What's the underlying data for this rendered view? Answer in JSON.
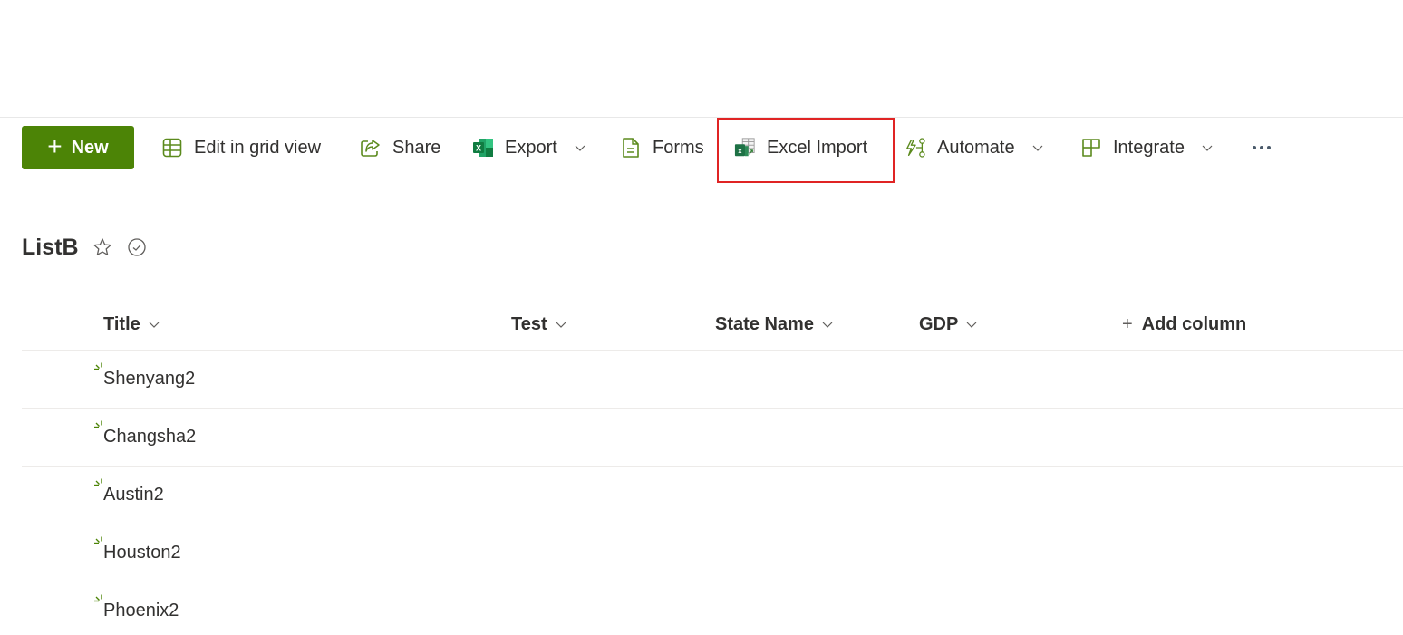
{
  "toolbar": {
    "new_label": "New",
    "items": [
      {
        "label": "Edit in grid view",
        "icon": "grid-icon",
        "has_dropdown": false
      },
      {
        "label": "Share",
        "icon": "share-icon",
        "has_dropdown": false
      },
      {
        "label": "Export",
        "icon": "excel-icon",
        "has_dropdown": true
      },
      {
        "label": "Forms",
        "icon": "form-document-icon",
        "has_dropdown": false
      },
      {
        "label": "Excel Import",
        "icon": "excel-import-icon",
        "has_dropdown": false,
        "highlighted": true
      },
      {
        "label": "Automate",
        "icon": "flow-icon",
        "has_dropdown": true
      },
      {
        "label": "Integrate",
        "icon": "integrate-icon",
        "has_dropdown": true
      }
    ],
    "more_icon": "more-ellipsis-icon"
  },
  "list": {
    "title": "ListB",
    "favorite_icon": "star-icon",
    "status_icon": "check-circle-icon",
    "columns": [
      {
        "label": "Title",
        "sortable": true
      },
      {
        "label": "Test",
        "sortable": true
      },
      {
        "label": "State Name",
        "sortable": true
      },
      {
        "label": "GDP",
        "sortable": true
      }
    ],
    "add_column_label": "Add column",
    "rows": [
      {
        "title": "Shenyang2",
        "is_new": true
      },
      {
        "title": "Changsha2",
        "is_new": true
      },
      {
        "title": "Austin2",
        "is_new": true
      },
      {
        "title": "Houston2",
        "is_new": true
      },
      {
        "title": "Phoenix2",
        "is_new": true
      }
    ]
  },
  "colors": {
    "brand_green": "#4c8406",
    "highlight_red": "#e02424",
    "text": "#323130",
    "divider": "#edebe9"
  }
}
